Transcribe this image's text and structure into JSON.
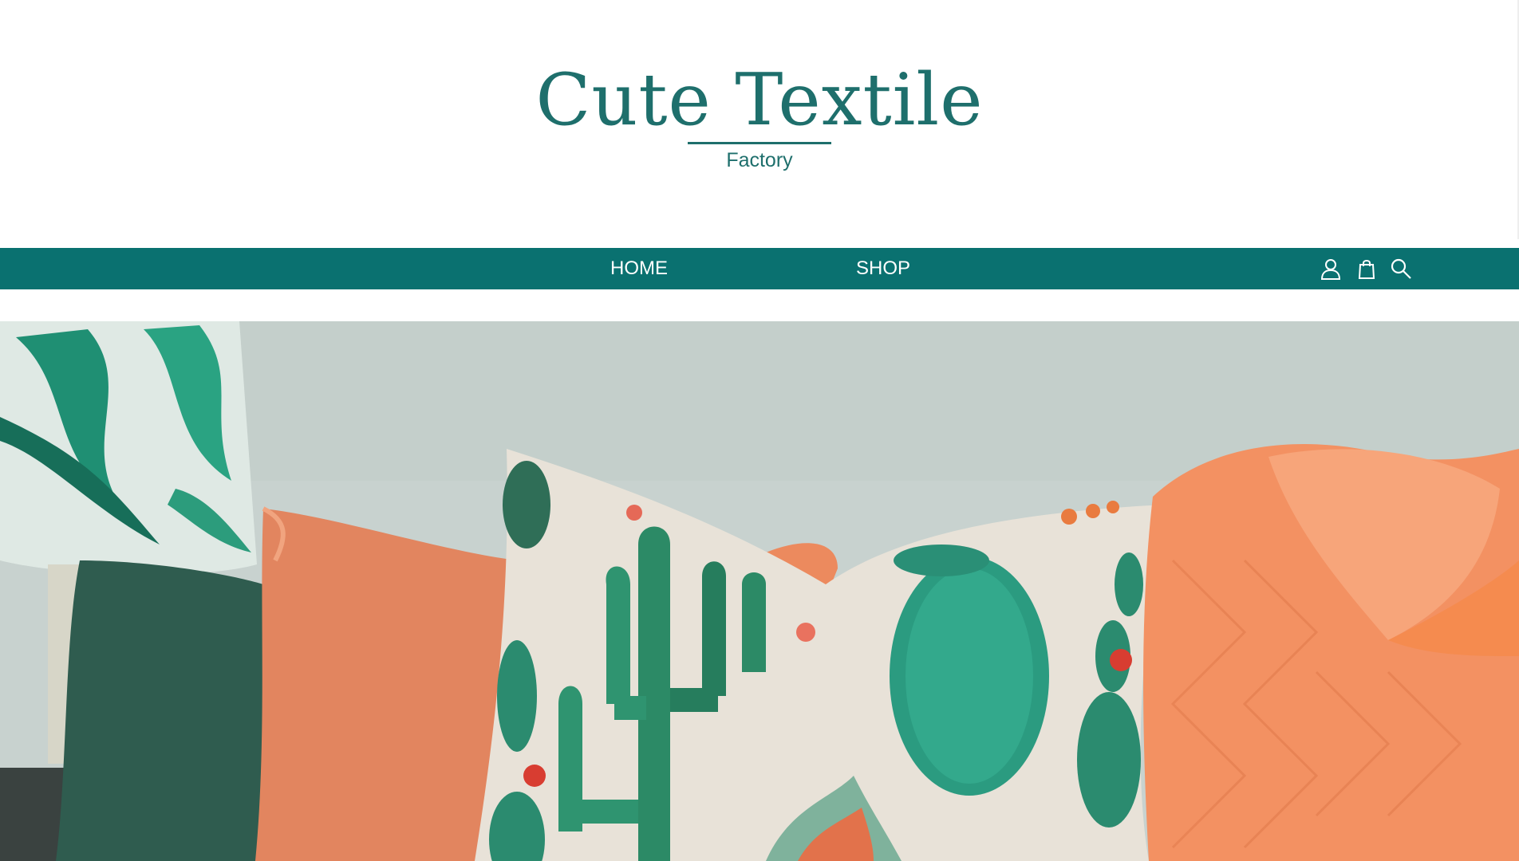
{
  "brand": {
    "title": "Cute Textile",
    "subtitle": "Factory",
    "color": "#1e6f6c"
  },
  "nav": {
    "background": "#0a7170",
    "items": [
      {
        "label": "HOME"
      },
      {
        "label": "SHOP"
      }
    ],
    "icons": [
      "user-icon",
      "shopping-bag-icon",
      "search-icon"
    ]
  },
  "hero": {
    "description_icon": "hero-image",
    "palette": {
      "wall": "#c9d3d0",
      "cushion_green": "#2f5c4f",
      "cushion_orange": "#e2855f",
      "blanket": "#f39162",
      "pillow": "#e6e0d6",
      "cactus": "#2c8a66"
    }
  }
}
